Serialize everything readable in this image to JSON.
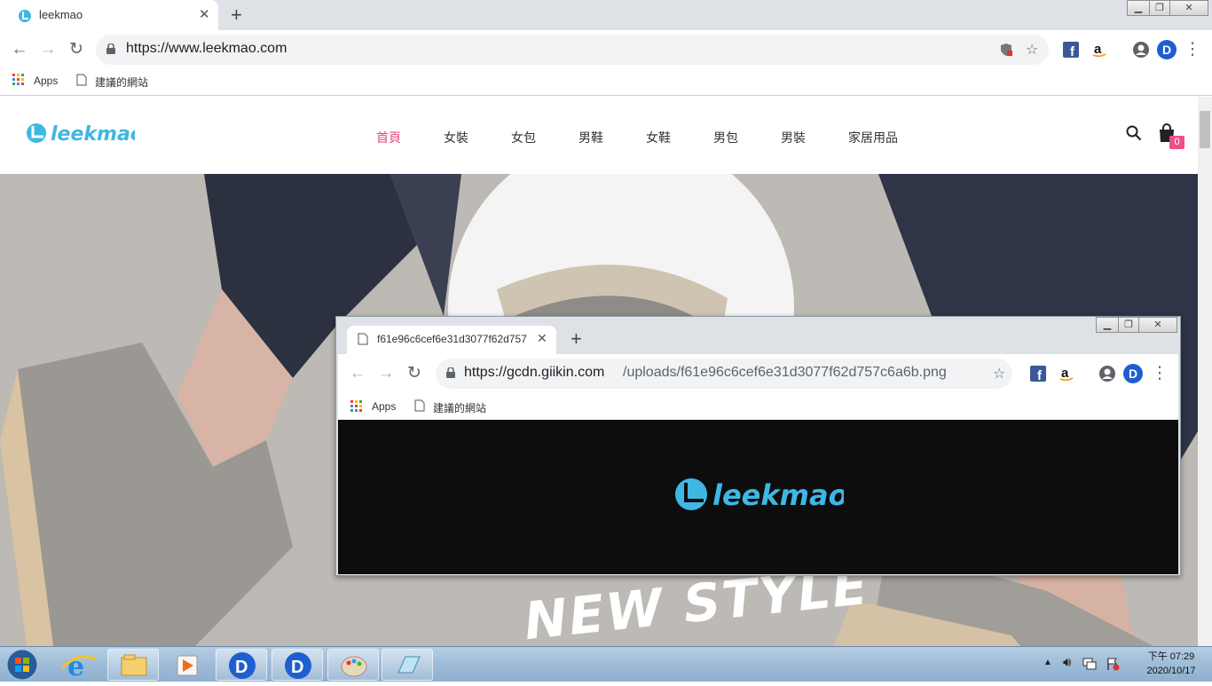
{
  "browser": {
    "tab_title": "leekmao",
    "url": "https://www.leekmao.com",
    "bookmarks": {
      "apps": "Apps",
      "suggested": "建議的網站"
    },
    "window_controls": [
      "minimize",
      "restore",
      "close"
    ]
  },
  "site": {
    "logo": "leekmao",
    "nav": [
      "首頁",
      "女裝",
      "女包",
      "男鞋",
      "女鞋",
      "男包",
      "男裝",
      "家居用品"
    ],
    "active_nav": "首頁",
    "cart_count": "0",
    "hero_text": "NEW STYLE"
  },
  "popup": {
    "tab_title": "f61e96c6cef6e31d3077f62d757",
    "url_host": "https://gcdn.giikin.com",
    "url_path": "/uploads/f61e96c6cef6e31d3077f62d757c6a6b.png",
    "bookmarks": {
      "apps": "Apps",
      "suggested": "建議的網站"
    },
    "logo": "leekmao"
  },
  "taskbar": {
    "time": "下午 07:29",
    "date": "2020/10/17"
  },
  "colors": {
    "brand_blue": "#3fb7e4",
    "brand_pink": "#f06a8a",
    "nav_active": "#e8457e",
    "cart_badge": "#f04e8a"
  }
}
